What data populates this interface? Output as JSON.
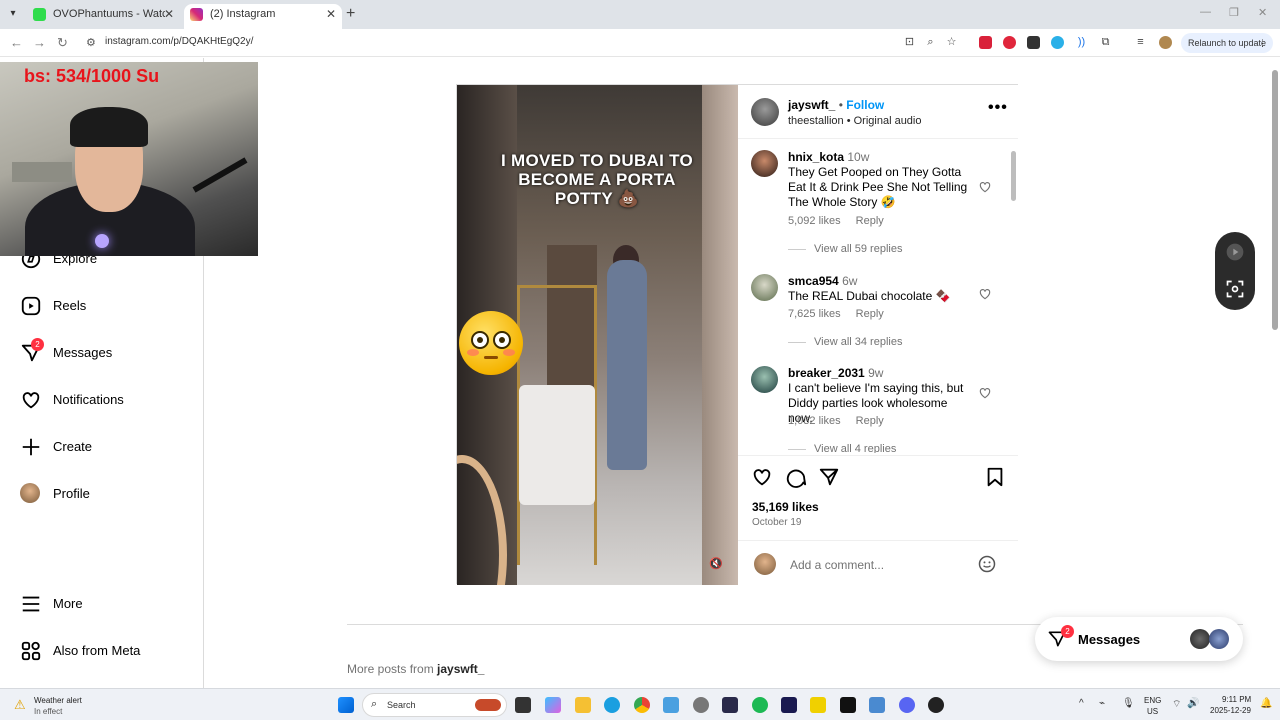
{
  "browser": {
    "tabs": [
      {
        "title": "OVOPhantuums - Watch clips o",
        "active": false
      },
      {
        "title": "(2) Instagram",
        "active": true
      }
    ],
    "url": "instagram.com/p/DQAKHtEgQ2y/",
    "relaunch_label": "Relaunch to update"
  },
  "webcam": {
    "counter_text": "bs: 534/1000  Su"
  },
  "sidebar": {
    "items": [
      {
        "label": "Explore",
        "icon": "compass-icon"
      },
      {
        "label": "Reels",
        "icon": "reels-icon"
      },
      {
        "label": "Messages",
        "icon": "messenger-icon",
        "badge": "2"
      },
      {
        "label": "Notifications",
        "icon": "heart-icon"
      },
      {
        "label": "Create",
        "icon": "plus-icon"
      },
      {
        "label": "Profile",
        "icon": "avatar"
      },
      {
        "label": "More",
        "icon": "menu-icon"
      },
      {
        "label": "Also from Meta",
        "icon": "meta-apps-icon"
      }
    ]
  },
  "post": {
    "caption_overlay": "I MOVED TO DUBAI TO BECOME A PORTA POTTY 💩",
    "author": "jayswft_",
    "follow_label": "Follow",
    "audio_line": "theestallion • Original audio",
    "comments": [
      {
        "user": "hnix_kota",
        "time": "10w",
        "text": "They Get Pooped on They Gotta Eat It & Drink Pee She Not Telling The Whole Story 🤣",
        "likes": "5,092 likes",
        "reply": "Reply",
        "view_replies": "View all 59 replies"
      },
      {
        "user": "smca954",
        "time": "6w",
        "text": "The REAL Dubai chocolate 🍫",
        "likes": "7,625 likes",
        "reply": "Reply",
        "view_replies": "View all 34 replies"
      },
      {
        "user": "breaker_2031",
        "time": "9w",
        "text": "I can't believe I'm saying this, but Diddy parties look wholesome now.",
        "likes": "1,032 likes",
        "reply": "Reply",
        "view_replies": "View all 4 replies"
      }
    ],
    "likes": "35,169 likes",
    "date": "October 19",
    "comment_placeholder": "Add a comment..."
  },
  "more_posts": {
    "prefix": "More posts from ",
    "user": "jayswft_"
  },
  "messages_pill": {
    "label": "Messages",
    "badge": "2"
  },
  "taskbar": {
    "weather_title": "Weather alert",
    "weather_sub": "In effect",
    "search_placeholder": "Search",
    "lang_top": "ENG",
    "lang_bottom": "US",
    "time": "9:11 PM",
    "date": "2025-12-29"
  },
  "colors": {
    "accent_blue": "#0095f6",
    "badge_red": "#ff3040",
    "counter_red": "#e8141b"
  }
}
